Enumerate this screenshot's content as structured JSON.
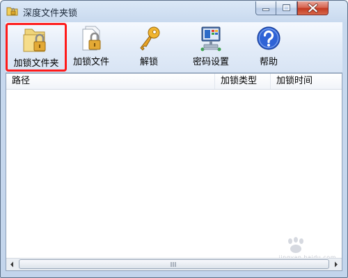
{
  "window": {
    "title": "深度文件夹锁"
  },
  "toolbar": {
    "buttons": [
      {
        "id": "lock-folder",
        "label": "加锁文件夹",
        "icon": "folder-lock-icon"
      },
      {
        "id": "lock-file",
        "label": "加锁文件",
        "icon": "file-lock-icon"
      },
      {
        "id": "unlock",
        "label": "解锁",
        "icon": "key-icon"
      },
      {
        "id": "password-settings",
        "label": "密码设置",
        "icon": "computer-settings-icon"
      },
      {
        "id": "help",
        "label": "帮助",
        "icon": "help-icon"
      }
    ],
    "highlight_color": "#ff1a1a"
  },
  "list": {
    "columns": [
      "路径",
      "加锁类型",
      "加锁时间"
    ],
    "rows": []
  },
  "watermark": {
    "text": "jingyan.baidu.com"
  }
}
